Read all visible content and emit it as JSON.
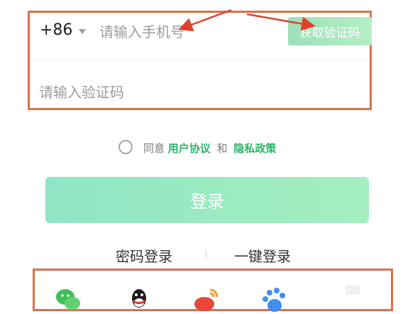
{
  "phone": {
    "country_code": "+86",
    "placeholder": "请输入手机号",
    "get_code_label": "获取验证码"
  },
  "code": {
    "placeholder": "请输入验证码"
  },
  "agreement": {
    "prefix": "同意",
    "user_agreement": "用户协议",
    "and": "和",
    "privacy_policy": "隐私政策"
  },
  "login_label": "登录",
  "alt_login": {
    "password": "密码登录",
    "one_click": "一键登录"
  },
  "social_icons": [
    "wechat-icon",
    "qq-icon",
    "weibo-icon",
    "baidu-icon"
  ],
  "colors": {
    "accent": "#2fb36b",
    "annotation": "#d9714a",
    "arrow": "#e0412c"
  }
}
